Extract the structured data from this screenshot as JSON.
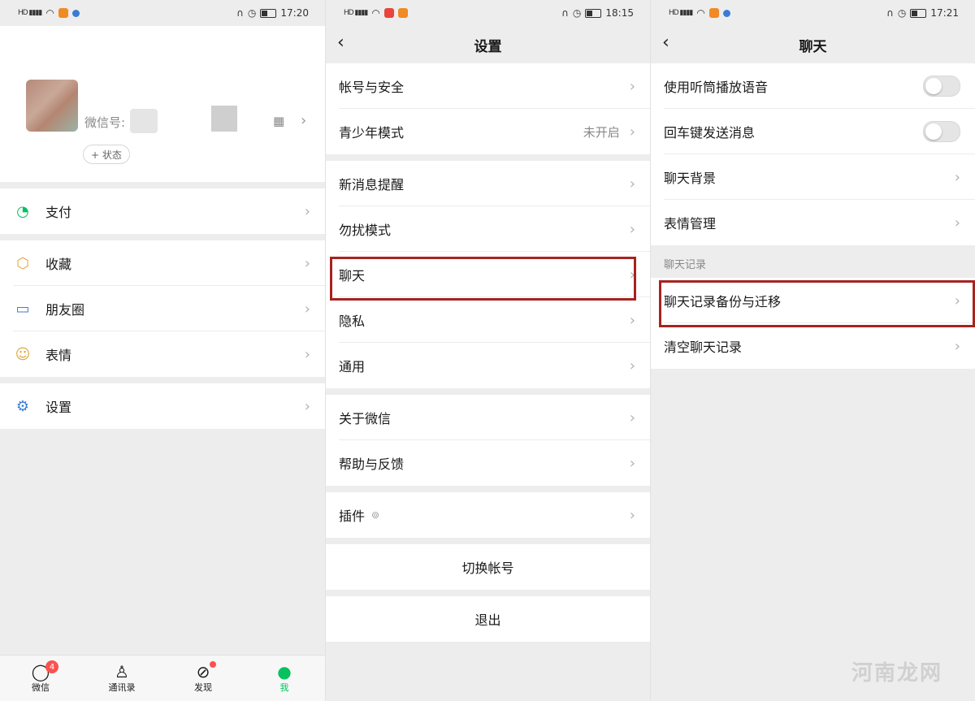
{
  "left": {
    "status_time": "17:20",
    "wechat_id_label": "微信号:",
    "state_button": "+ 状态",
    "menu": [
      {
        "label": "支付"
      },
      {
        "label": "收藏"
      },
      {
        "label": "朋友圈"
      },
      {
        "label": "表情"
      },
      {
        "label": "设置"
      }
    ],
    "tabs": [
      {
        "label": "微信",
        "badge": "4"
      },
      {
        "label": "通讯录"
      },
      {
        "label": "发现"
      },
      {
        "label": "我"
      }
    ]
  },
  "middle": {
    "status_time": "18:15",
    "title": "设置",
    "rows": [
      {
        "label": "帐号与安全"
      },
      {
        "label": "青少年模式",
        "value": "未开启"
      },
      {
        "label": "新消息提醒"
      },
      {
        "label": "勿扰模式"
      },
      {
        "label": "聊天"
      },
      {
        "label": "隐私"
      },
      {
        "label": "通用"
      },
      {
        "label": "关于微信"
      },
      {
        "label": "帮助与反馈"
      },
      {
        "label": "插件"
      }
    ],
    "switch_account": "切换帐号",
    "logout": "退出"
  },
  "right": {
    "status_time": "17:21",
    "title": "聊天",
    "rows": [
      {
        "label": "使用听筒播放语音",
        "toggle": false
      },
      {
        "label": "回车键发送消息",
        "toggle": false
      },
      {
        "label": "聊天背景"
      },
      {
        "label": "表情管理"
      }
    ],
    "section_title": "聊天记录",
    "history_rows": [
      {
        "label": "聊天记录备份与迁移"
      },
      {
        "label": "清空聊天记录"
      }
    ]
  },
  "watermark": "河南龙网",
  "colors": {
    "highlight": "#a6231f",
    "wechat_green": "#07c160",
    "badge_red": "#fa5151"
  }
}
